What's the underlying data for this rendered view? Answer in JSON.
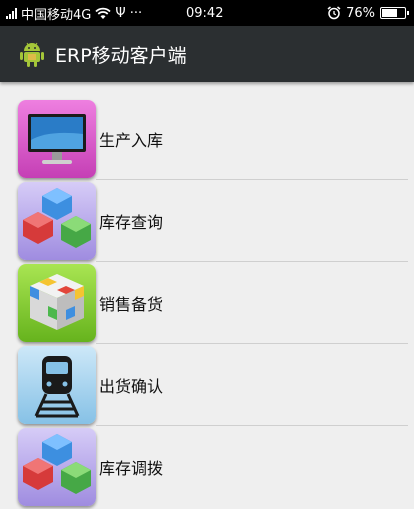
{
  "status_bar": {
    "carrier": "中国移动4G",
    "extra": "Ψ ···",
    "time": "09:42",
    "battery": "76%",
    "battery_level": 0.76
  },
  "action_bar": {
    "title": "ERP移动客户端",
    "icon": "android-icon"
  },
  "menu": {
    "items": [
      {
        "label": "生产入库",
        "icon": "monitor-icon"
      },
      {
        "label": "库存查询",
        "icon": "cubes-icon"
      },
      {
        "label": "销售备货",
        "icon": "rubiks-cube-icon"
      },
      {
        "label": "出货确认",
        "icon": "train-icon"
      },
      {
        "label": "库存调拨",
        "icon": "cubes-icon"
      }
    ]
  },
  "colors": {
    "action_bar": "#2b2f31",
    "background": "#efefef",
    "tile_pink": "#d855c8",
    "tile_lavender": "#b9a8e8",
    "tile_green": "#8dcf2c",
    "tile_blue": "#a8d4ee"
  }
}
